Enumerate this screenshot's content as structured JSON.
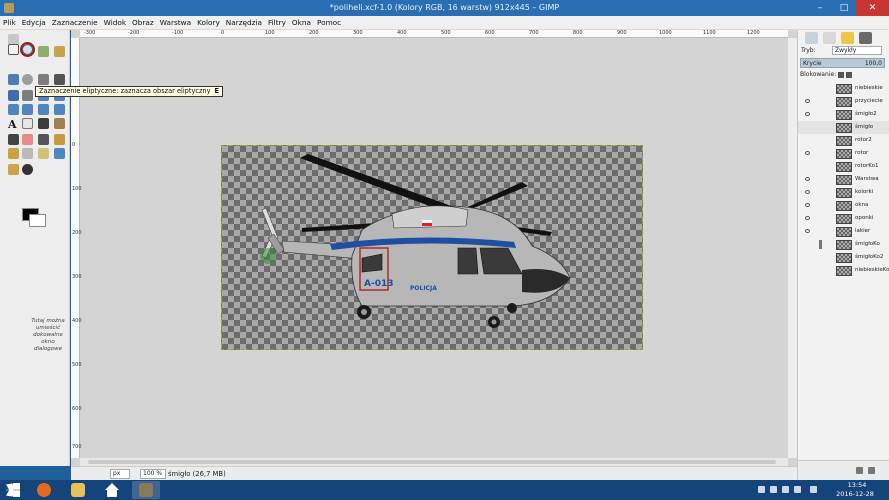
{
  "window": {
    "title": "*poliheli.xcf-1.0 (Kolory RGB, 16 warstw) 912x445 – GIMP",
    "min_icon": "minimize-icon",
    "max_icon": "maximize-icon",
    "close_icon": "close-icon",
    "min_glyph": "–",
    "max_glyph": "□",
    "close_glyph": "✕"
  },
  "menu": {
    "items": [
      "Plik",
      "Edycja",
      "Zaznaczenie",
      "Widok",
      "Obraz",
      "Warstwa",
      "Kolory",
      "Narzędzia",
      "Filtry",
      "Okna",
      "Pomoc"
    ]
  },
  "toolbox": {
    "tooltip": "Zaznaczenie eliptyczne: zaznacza obszar eliptyczny",
    "tooltip_shortcut": "E",
    "dock_hint": "Tutaj można umieścić dokowalne okno dialogowe"
  },
  "rulers": {
    "top": [
      "-300",
      "-200",
      "-100",
      "0",
      "100",
      "200",
      "300",
      "400",
      "500",
      "600",
      "700",
      "800",
      "900",
      "1000",
      "1100",
      "1200"
    ],
    "left": [
      "0",
      "100",
      "200",
      "300",
      "400",
      "500",
      "600",
      "700"
    ]
  },
  "status": {
    "unit": "px",
    "zoom": "100 %",
    "info": "śmigło (26,7 MB)"
  },
  "layers_panel": {
    "mode_label": "Tryb:",
    "mode_value": "Zwykły",
    "opacity_label": "Krycie",
    "opacity_value": "100,0",
    "lock_label": "Blokowanie:",
    "layers": [
      {
        "name": "niebieskie",
        "visible": false,
        "active": false
      },
      {
        "name": "przyciecie",
        "visible": true,
        "active": false
      },
      {
        "name": "śmigło2",
        "visible": true,
        "active": false
      },
      {
        "name": "śmigło",
        "visible": false,
        "active": true
      },
      {
        "name": "rotor2",
        "visible": false,
        "active": false
      },
      {
        "name": "rotor",
        "visible": true,
        "active": false
      },
      {
        "name": "rotorKo1",
        "visible": false,
        "active": false
      },
      {
        "name": "Warstwa",
        "visible": true,
        "active": false
      },
      {
        "name": "kolorki",
        "visible": true,
        "active": false
      },
      {
        "name": "okna",
        "visible": true,
        "active": false
      },
      {
        "name": "oponki",
        "visible": true,
        "active": false
      },
      {
        "name": "lakier",
        "visible": true,
        "active": false
      },
      {
        "name": "śmigłoKo",
        "visible": false,
        "active": false
      },
      {
        "name": "śmigłoKo2",
        "visible": false,
        "active": false
      },
      {
        "name": "niebieskieKo",
        "visible": false,
        "active": false
      }
    ]
  },
  "canvas": {
    "aircraft_labels": [
      "A-013",
      "POLICJA"
    ]
  },
  "taskbar": {
    "time": "13:54",
    "date": "2016-12-28"
  }
}
